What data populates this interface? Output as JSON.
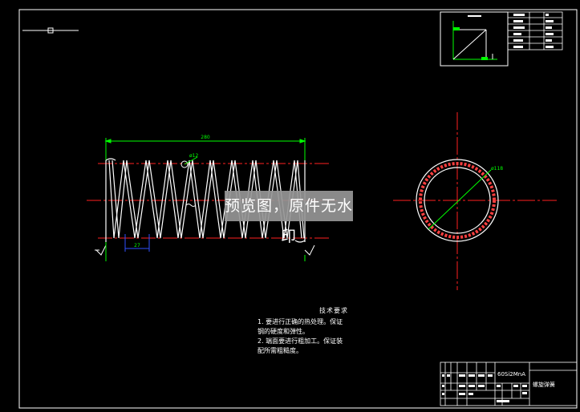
{
  "drawing": {
    "background": "#000000",
    "line_color": "#ffffff",
    "center_line_color": "#ff2020",
    "dimension_color": "#00ff00",
    "dimension_color_blue": "#3050ff"
  },
  "dimensions": {
    "free_length": "280",
    "wire_diameter": "ø12",
    "pitch": "27",
    "outer_diameter": "ø118"
  },
  "tech_requirements": {
    "title": "技术要求",
    "line1": "1. 要进行正确的热处理。保证",
    "line2": "钢的硬度和弹性。",
    "line3": "2. 端面要进行粗加工。保证装",
    "line4": "配所需粗糙度。"
  },
  "watermark": "预览图，原件无水印",
  "title_block": {
    "material": "60Si2MnA",
    "part_name": "螺旋弹簧"
  }
}
